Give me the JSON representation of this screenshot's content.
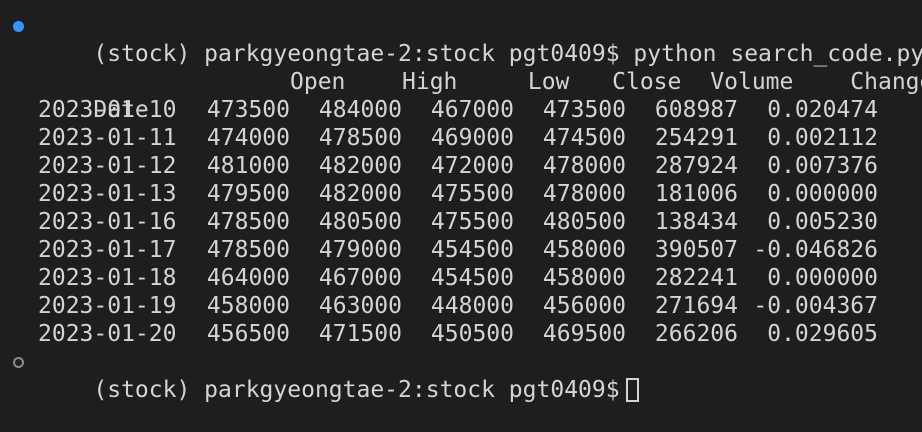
{
  "terminal": {
    "prompt_line": "(stock) parkgyeongtae-2:stock pgt0409$ python search_code.py",
    "final_prompt": "(stock) parkgyeongtae-2:stock pgt0409$",
    "columns": [
      "Open",
      "High",
      "Low",
      "Close",
      "Volume",
      "Change"
    ],
    "index_label": "Date",
    "rows": [
      [
        "2023-01-10",
        "473500",
        "484000",
        "467000",
        "473500",
        "608987",
        "0.020474"
      ],
      [
        "2023-01-11",
        "474000",
        "478500",
        "469000",
        "474500",
        "254291",
        "0.002112"
      ],
      [
        "2023-01-12",
        "481000",
        "482000",
        "472000",
        "478000",
        "287924",
        "0.007376"
      ],
      [
        "2023-01-13",
        "479500",
        "482000",
        "475500",
        "478000",
        "181006",
        "0.000000"
      ],
      [
        "2023-01-16",
        "478500",
        "480500",
        "475500",
        "480500",
        "138434",
        "0.005230"
      ],
      [
        "2023-01-17",
        "478500",
        "479000",
        "454500",
        "458000",
        "390507",
        "-0.046826"
      ],
      [
        "2023-01-18",
        "464000",
        "467000",
        "454500",
        "458000",
        "282241",
        "0.000000"
      ],
      [
        "2023-01-19",
        "458000",
        "463000",
        "448000",
        "456000",
        "271694",
        "-0.004367"
      ],
      [
        "2023-01-20",
        "456500",
        "471500",
        "450500",
        "469500",
        "266206",
        "0.029605"
      ]
    ],
    "colors": {
      "background": "#1e1e1e",
      "text": "#d4d4d4",
      "success_marker": "#3794ff",
      "idle_marker": "#8a8a8a"
    }
  }
}
